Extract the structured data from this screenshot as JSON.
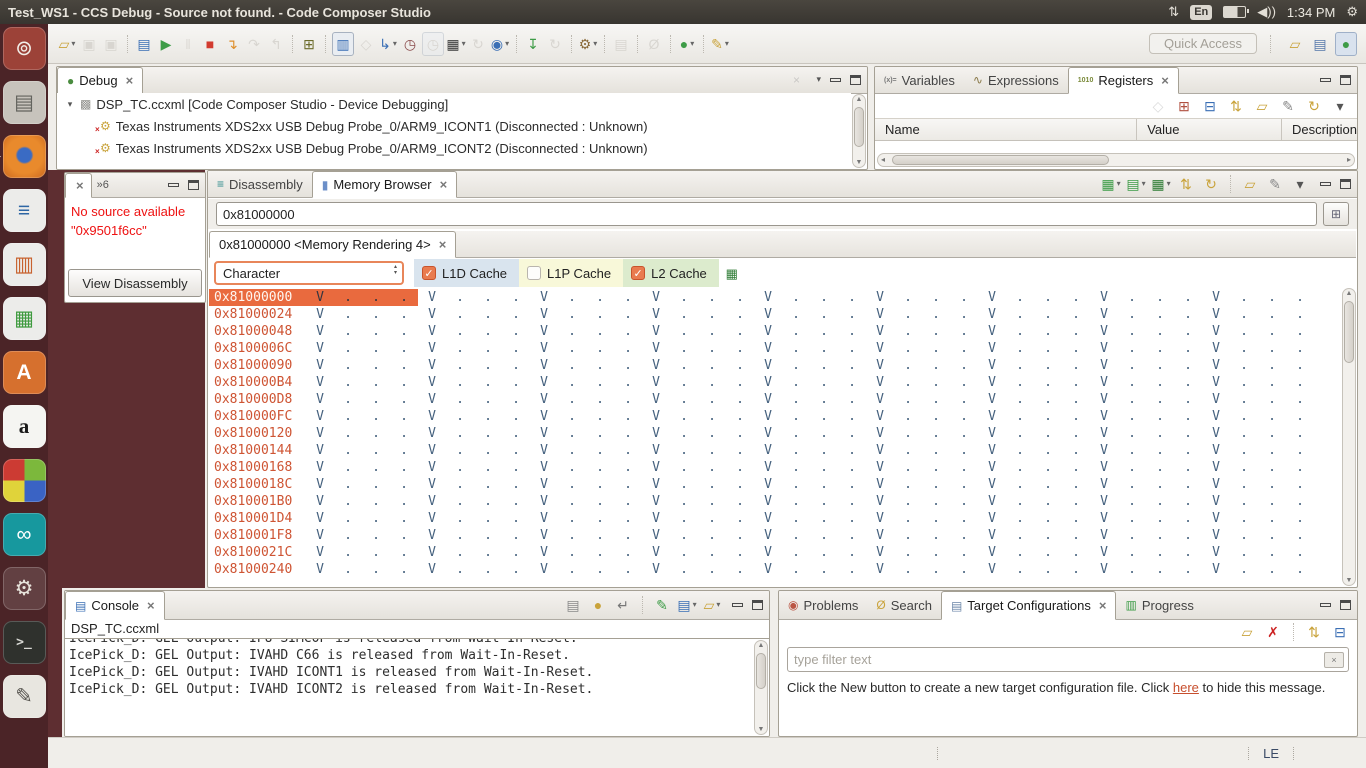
{
  "titlebar": {
    "title": "Test_WS1 - CCS Debug - Source not found. - Code Composer Studio",
    "language": "En",
    "time": "1:34 PM"
  },
  "launcher": {
    "items": [
      {
        "n": "ubuntu-dash",
        "cls": "t-dash",
        "g": "⊚",
        "fg": "#F2EFE9"
      },
      {
        "n": "file-manager",
        "cls": "t-files",
        "g": "▤",
        "fg": "#63635E"
      },
      {
        "n": "firefox",
        "cls": "t-firefox",
        "g": "",
        "fg": "",
        "active": true
      },
      {
        "n": "libreoffice-writer",
        "cls": "t-doc",
        "g": "≡",
        "fg": "#2E66A4"
      },
      {
        "n": "libreoffice-impress",
        "cls": "t-doc",
        "g": "▥",
        "fg": "#C8622F"
      },
      {
        "n": "libreoffice-calc",
        "cls": "t-doc",
        "g": "▦",
        "fg": "#3E9A3E"
      },
      {
        "n": "software-center",
        "cls": "t-soft",
        "g": "A",
        "fg": "#FFFFFF"
      },
      {
        "n": "amazon",
        "cls": "t-amazon",
        "g": "a",
        "fg": "#1A1A1A"
      },
      {
        "n": "blocks-app",
        "cls": "t-blocks",
        "g": "",
        "fg": ""
      },
      {
        "n": "arduino",
        "cls": "t-arduino",
        "g": "∞",
        "fg": "#FFFFFF"
      },
      {
        "n": "system-settings",
        "cls": "",
        "g": "⚙",
        "fg": "#E6E2DA"
      },
      {
        "n": "terminal",
        "cls": "t-terminal",
        "g": ">_",
        "fg": "#D8D8D4"
      },
      {
        "n": "notes-stack",
        "cls": "t-notes",
        "g": "✎",
        "fg": "#55534E"
      }
    ]
  },
  "toolbar": {
    "quick_access": "Quick Access",
    "icons": [
      {
        "n": "new",
        "g": "▱",
        "c": "#C9A33B",
        "dd": true
      },
      {
        "n": "save",
        "g": "▣",
        "c": "#B9B5AE",
        "dis": true
      },
      {
        "n": "save-all",
        "g": "▣",
        "c": "#B9B5AE",
        "dis": true
      },
      {
        "sep": true
      },
      {
        "n": "debug-console",
        "g": "▤",
        "c": "#3B6FB5"
      },
      {
        "n": "resume",
        "g": "▶",
        "c": "#3E9C47"
      },
      {
        "n": "suspend",
        "g": "‖",
        "c": "#C4BFB8",
        "dis": true
      },
      {
        "n": "terminate",
        "g": "■",
        "c": "#D23B2F"
      },
      {
        "n": "step-into",
        "g": "↴",
        "c": "#DE8F2C"
      },
      {
        "n": "step-over",
        "g": "↷",
        "c": "#B9B5AE",
        "dis": true
      },
      {
        "n": "step-return",
        "g": "↰",
        "c": "#B9B5AE",
        "dis": true
      },
      {
        "sep": true
      },
      {
        "n": "view-memory",
        "g": "⊞",
        "c": "#6B6B2A"
      },
      {
        "sep": true
      },
      {
        "n": "connect-target",
        "g": "▥",
        "c": "#3B6FB5",
        "fr": true
      },
      {
        "n": "source-lookup",
        "g": "◇",
        "c": "#B9B5AE",
        "dis": true
      },
      {
        "n": "restore-views",
        "g": "↳",
        "c": "#3B6FB5",
        "dd": true
      },
      {
        "n": "profile",
        "g": "◷",
        "c": "#8A4A4A"
      },
      {
        "n": "profile-setup",
        "g": "◷",
        "c": "#B9B5AE",
        "dis": true,
        "fr": true
      },
      {
        "n": "flash",
        "g": "▦",
        "c": "#3A3A3A",
        "dd": true
      },
      {
        "n": "refresh-target",
        "g": "↻",
        "c": "#B9B5AE",
        "dis": true
      },
      {
        "n": "new-target-config",
        "g": "◉",
        "c": "#3B6FB5",
        "dd": true
      },
      {
        "sep": true
      },
      {
        "n": "trace",
        "g": "↧",
        "c": "#3E9C47"
      },
      {
        "n": "reset-target",
        "g": "↻",
        "c": "#B9B5AE",
        "dis": true
      },
      {
        "sep": true
      },
      {
        "n": "build",
        "g": "⚙",
        "c": "#8A6A3A",
        "dd": true
      },
      {
        "sep": true
      },
      {
        "n": "open-console-tb",
        "g": "▤",
        "c": "#B9B5AE",
        "dis": true
      },
      {
        "sep": true
      },
      {
        "n": "search",
        "g": "Ø",
        "c": "#B9B5AE",
        "dis": true
      },
      {
        "sep": true
      },
      {
        "n": "debug-launch",
        "g": "●",
        "c": "#3E9C47",
        "dd": true
      },
      {
        "sep": true
      },
      {
        "n": "flash-run",
        "g": "✎",
        "c": "#C9A33B",
        "dd": true
      }
    ],
    "perspectives": [
      {
        "n": "open-perspective",
        "g": "▱",
        "c": "#C9A33B"
      },
      {
        "n": "ccs-edit-perspective",
        "g": "▤",
        "c": "#5577AA"
      },
      {
        "n": "ccs-debug-perspective",
        "g": "●",
        "c": "#3E9C47",
        "pressed": true
      }
    ]
  },
  "debug_view": {
    "tabs": [
      {
        "label": "Debug",
        "active": true,
        "close": true,
        "icon": {
          "g": "●",
          "c": "#4A8C3F"
        }
      }
    ],
    "toolbar": [
      {
        "n": "remove-all",
        "g": "×",
        "c": "#999999",
        "dis": true
      }
    ],
    "tree": [
      {
        "level": 0,
        "expander": "▾",
        "icon": {
          "g": "▩",
          "c": "#8F8F8B"
        },
        "label": "DSP_TC.ccxml [Code Composer Studio - Device Debugging]"
      },
      {
        "level": 1,
        "icon": {
          "g": "⚙",
          "c": "#C9A33B",
          "badge": "×"
        },
        "label": "Texas Instruments XDS2xx USB Debug Probe_0/ARM9_ICONT1 (Disconnected : Unknown)"
      },
      {
        "level": 1,
        "icon": {
          "g": "⚙",
          "c": "#C9A33B",
          "badge": "×"
        },
        "label": "Texas Instruments XDS2xx USB Debug Probe_0/ARM9_ICONT2 (Disconnected : Unknown)"
      }
    ]
  },
  "vars_view": {
    "tabs": [
      {
        "label": "Variables",
        "icon": {
          "g": "(x)=",
          "c": "#777777",
          "cls": "txt"
        }
      },
      {
        "label": "Expressions",
        "icon": {
          "g": "∿",
          "c": "#8A7A4A"
        }
      },
      {
        "label": "Registers",
        "active": true,
        "close": true,
        "icon": {
          "g": "1010",
          "c": "#7A8A3A",
          "cls": "txt"
        }
      }
    ],
    "toolbar": [
      {
        "n": "show-type-names",
        "g": "◇",
        "c": "#AAAAAA",
        "dis": true
      },
      {
        "n": "add-register-group",
        "g": "⊞",
        "c": "#B05040"
      },
      {
        "n": "collapse-all",
        "g": "⊟",
        "c": "#3B6FB5"
      },
      {
        "n": "reorder",
        "g": "⇅",
        "c": "#C9A33B"
      },
      {
        "n": "new-view",
        "g": "▱",
        "c": "#C9A33B"
      },
      {
        "n": "pin-view",
        "g": "✎",
        "c": "#888888"
      },
      {
        "n": "refresh",
        "g": "↻",
        "c": "#C9A33B"
      },
      {
        "n": "view-menu",
        "g": "▾",
        "c": "#555555"
      }
    ],
    "columns": [
      "Name",
      "Value",
      "Description"
    ]
  },
  "source_view": {
    "more_tabs": "»6",
    "error_line1": "No source available",
    "error_line2": "\"0x9501f6cc\"",
    "button": "View Disassembly"
  },
  "memory_view": {
    "tabs": [
      {
        "label": "Disassembly",
        "icon": {
          "g": "≡",
          "c": "#2E8B8B"
        }
      },
      {
        "label": "Memory Browser",
        "active": true,
        "close": true,
        "icon": {
          "g": "▮",
          "c": "#6C8FC8"
        }
      }
    ],
    "toolbar": [
      {
        "n": "select-device",
        "g": "▦",
        "c": "#3E9C47",
        "dd": true
      },
      {
        "n": "save-memory",
        "g": "▤",
        "c": "#3E9C47",
        "dd": true
      },
      {
        "n": "load-memory",
        "g": "▦",
        "c": "#2E7C35",
        "dd": true
      },
      {
        "n": "swap",
        "g": "⇅",
        "c": "#C9A33B"
      },
      {
        "n": "refresh",
        "g": "↻",
        "c": "#C9A33B"
      },
      {
        "sep": true
      },
      {
        "n": "new-tab",
        "g": "▱",
        "c": "#C9A33B"
      },
      {
        "n": "pin-view",
        "g": "✎",
        "c": "#888888"
      },
      {
        "n": "view-menu",
        "g": "▾",
        "c": "#555555"
      }
    ],
    "address": "0x81000000",
    "rendering_tab": "0x81000000 <Memory Rendering 4>",
    "format": "Character",
    "caches": [
      {
        "label": "L1D Cache",
        "checked": true,
        "bg": "#D9E4EE"
      },
      {
        "label": "L1P Cache",
        "checked": false,
        "bg": "#F8F8D9"
      },
      {
        "label": "L2 Cache",
        "checked": true,
        "bg": "#DCEBCD"
      }
    ],
    "addresses": [
      "0x81000000",
      "0x81000024",
      "0x81000048",
      "0x8100006C",
      "0x81000090",
      "0x810000B4",
      "0x810000D8",
      "0x810000FC",
      "0x81000120",
      "0x81000144",
      "0x81000168",
      "0x8100018C",
      "0x810001B0",
      "0x810001D4",
      "0x810001F8",
      "0x8100021C",
      "0x81000240"
    ],
    "pattern": [
      "V",
      ".",
      ".",
      "."
    ],
    "groups_per_row": 9,
    "selected_row": 0
  },
  "console_view": {
    "tabs": [
      {
        "label": "Console",
        "active": true,
        "close": true,
        "icon": {
          "g": "▤",
          "c": "#3B6FB5"
        }
      }
    ],
    "toolbar": [
      {
        "n": "clear-console",
        "g": "▤",
        "c": "#8A8A8A"
      },
      {
        "n": "scroll-lock",
        "g": "●",
        "c": "#C9A33B"
      },
      {
        "n": "word-wrap",
        "g": "↵",
        "c": "#777777"
      },
      {
        "sep": true
      },
      {
        "n": "pin-console",
        "g": "✎",
        "c": "#3E9C47"
      },
      {
        "n": "display-console",
        "g": "▤",
        "c": "#3B6FB5",
        "dd": true
      },
      {
        "n": "open-console",
        "g": "▱",
        "c": "#C9A33B",
        "dd": true
      }
    ],
    "context": "DSP_TC.ccxml",
    "lines": [
      "IcePick_D: GEL Output: IPU SIMCOP is released from Wait-In-Reset.",
      "IcePick_D: GEL Output: IVAHD C66 is released from Wait-In-Reset.",
      "IcePick_D: GEL Output: IVAHD ICONT1 is released from Wait-In-Reset.",
      "IcePick_D: GEL Output: IVAHD ICONT2 is released from Wait-In-Reset."
    ]
  },
  "config_view": {
    "tabs": [
      {
        "label": "Problems",
        "icon": {
          "g": "◉",
          "c": "#BB5544"
        }
      },
      {
        "label": "Search",
        "icon": {
          "g": "Ø",
          "c": "#C9A33B"
        }
      },
      {
        "label": "Target Configurations",
        "active": true,
        "close": true,
        "icon": {
          "g": "▤",
          "c": "#6B86A8"
        }
      },
      {
        "label": "Progress",
        "icon": {
          "g": "▥",
          "c": "#3E9C47"
        }
      }
    ],
    "toolbar": [
      {
        "n": "new-configuration",
        "g": "▱",
        "c": "#C9A33B"
      },
      {
        "n": "delete-configuration",
        "g": "✗",
        "c": "#CC2222"
      },
      {
        "sep": true
      },
      {
        "n": "refresh",
        "g": "⇅",
        "c": "#C9A33B"
      },
      {
        "n": "collapse-all",
        "g": "⊟",
        "c": "#3B6FB5"
      }
    ],
    "filter_placeholder": "type filter text",
    "message_pre": "Click the New button to create a new target configuration file. Click ",
    "message_link": "here",
    "message_post": " to hide this message."
  },
  "statusbar": {
    "endianness": "LE"
  }
}
